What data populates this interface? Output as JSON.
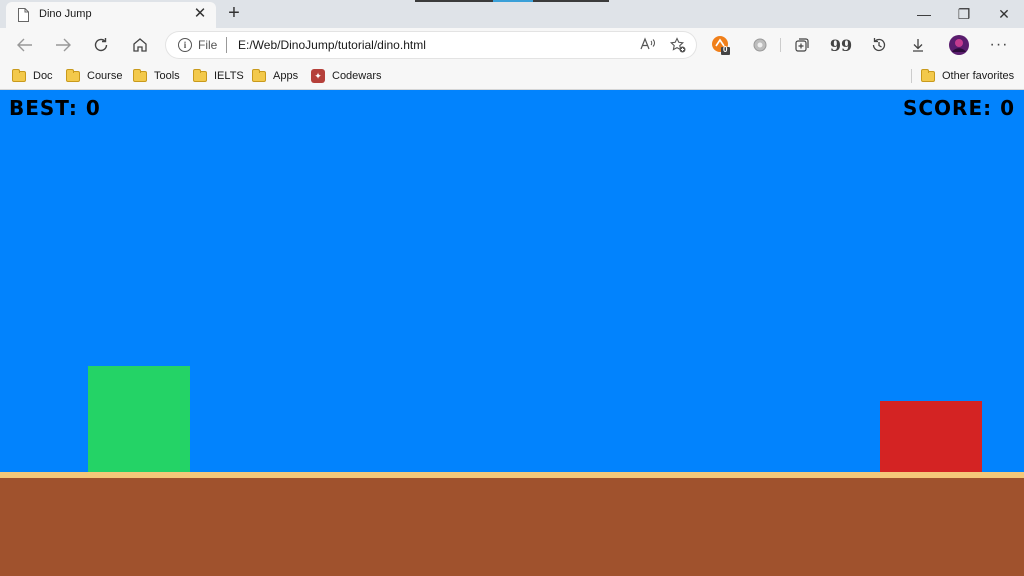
{
  "browser": {
    "tab": {
      "title": "Dino Jump",
      "close": "✕"
    },
    "new_tab": "+",
    "window_controls": {
      "minimize": "—",
      "restore": "❐",
      "close": "✕"
    },
    "address": {
      "scheme": "File",
      "url": "E:/Web/DinoJump/tutorial/dino.html"
    },
    "extension_badge": "0",
    "bookmarks": [
      {
        "label": "Doc",
        "icon": "folder-icon"
      },
      {
        "label": "Course",
        "icon": "folder-icon"
      },
      {
        "label": "Tools",
        "icon": "folder-icon"
      },
      {
        "label": "IELTS",
        "icon": "folder-icon"
      },
      {
        "label": "Apps",
        "icon": "folder-icon"
      },
      {
        "label": "Codewars",
        "icon": "codewars-icon"
      }
    ],
    "other_favorites": "Other favorites"
  },
  "game": {
    "best_text": "BEST: 0",
    "score_text": "SCORE: 0",
    "colors": {
      "sky": "#0283fd",
      "player": "#24d366",
      "obstacle": "#d42323",
      "ground_edge": "#f4c879",
      "ground": "#a0522d"
    }
  }
}
